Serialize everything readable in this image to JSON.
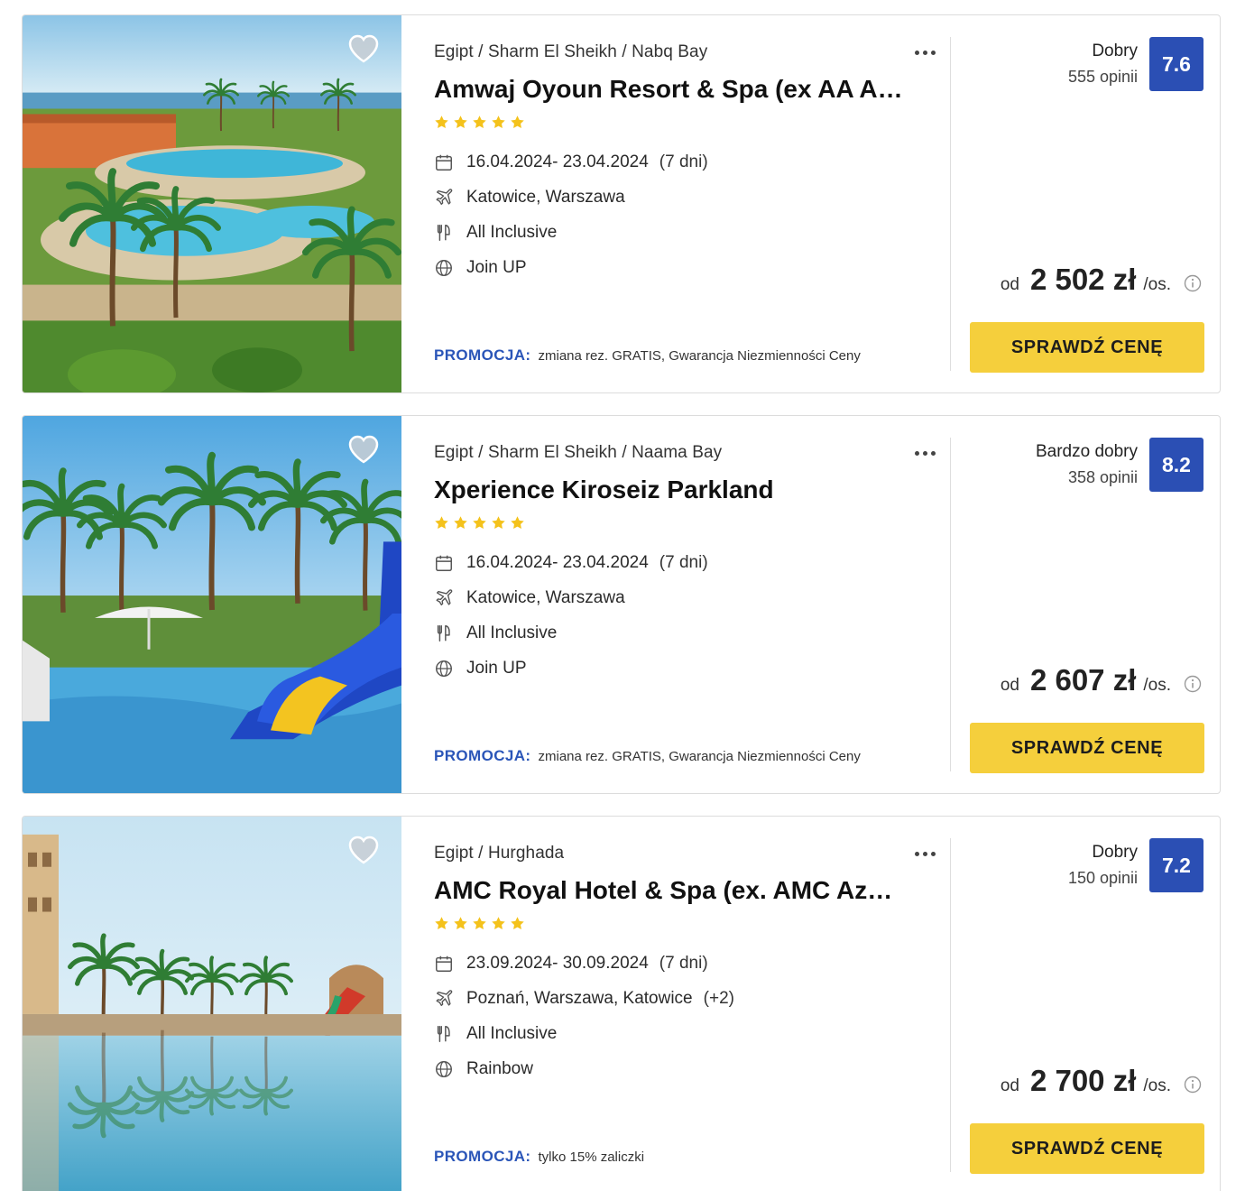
{
  "colors": {
    "accent_blue": "#2b4fb4",
    "promo_blue": "#2a55b8",
    "cta_yellow": "#f5cf3c",
    "star_yellow": "#f4c21b"
  },
  "offers": [
    {
      "location": "Egipt / Sharm El Sheikh / Nabq Bay",
      "name": "Amwaj Oyoun Resort & Spa (ex AA A…",
      "stars": 5,
      "dates": "16.04.2024- 23.04.2024",
      "duration": "(7 dni)",
      "departure": "Katowice, Warszawa",
      "departure_extra": "",
      "board": "All Inclusive",
      "operator": "Join UP",
      "promo_label": "PROMOCJA:",
      "promo_text": "zmiana rez. GRATIS, Gwarancja Niezmienności Ceny",
      "rating_label": "Dobry",
      "rating_count": "555 opinii",
      "score": "7.6",
      "price_from": "od",
      "price": "2 502 zł",
      "price_unit": "/os.",
      "cta": "SPRAWDŹ CENĘ",
      "image": "resort-pool-sea-view"
    },
    {
      "location": "Egipt / Sharm El Sheikh / Naama Bay",
      "name": "Xperience Kiroseiz Parkland",
      "stars": 5,
      "dates": "16.04.2024- 23.04.2024",
      "duration": "(7 dni)",
      "departure": "Katowice, Warszawa",
      "departure_extra": "",
      "board": "All Inclusive",
      "operator": "Join UP",
      "promo_label": "PROMOCJA:",
      "promo_text": "zmiana rez. GRATIS, Gwarancja Niezmienności Ceny",
      "rating_label": "Bardzo dobry",
      "rating_count": "358 opinii",
      "score": "8.2",
      "price_from": "od",
      "price": "2 607 zł",
      "price_unit": "/os.",
      "cta": "SPRAWDŹ CENĘ",
      "image": "palm-trees-water-slides"
    },
    {
      "location": "Egipt / Hurghada",
      "name": "AMC Royal Hotel & Spa (ex. AMC Azu…",
      "stars": 5,
      "dates": "23.09.2024- 30.09.2024",
      "duration": "(7 dni)",
      "departure": "Poznań, Warszawa, Katowice",
      "departure_extra": "(+2)",
      "board": "All Inclusive",
      "operator": "Rainbow",
      "promo_label": "PROMOCJA:",
      "promo_text": "tylko 15% zaliczki",
      "rating_label": "Dobry",
      "rating_count": "150 opinii",
      "score": "7.2",
      "price_from": "od",
      "price": "2 700 zł",
      "price_unit": "/os.",
      "cta": "SPRAWDŹ CENĘ",
      "image": "pool-reflection-palms"
    }
  ]
}
